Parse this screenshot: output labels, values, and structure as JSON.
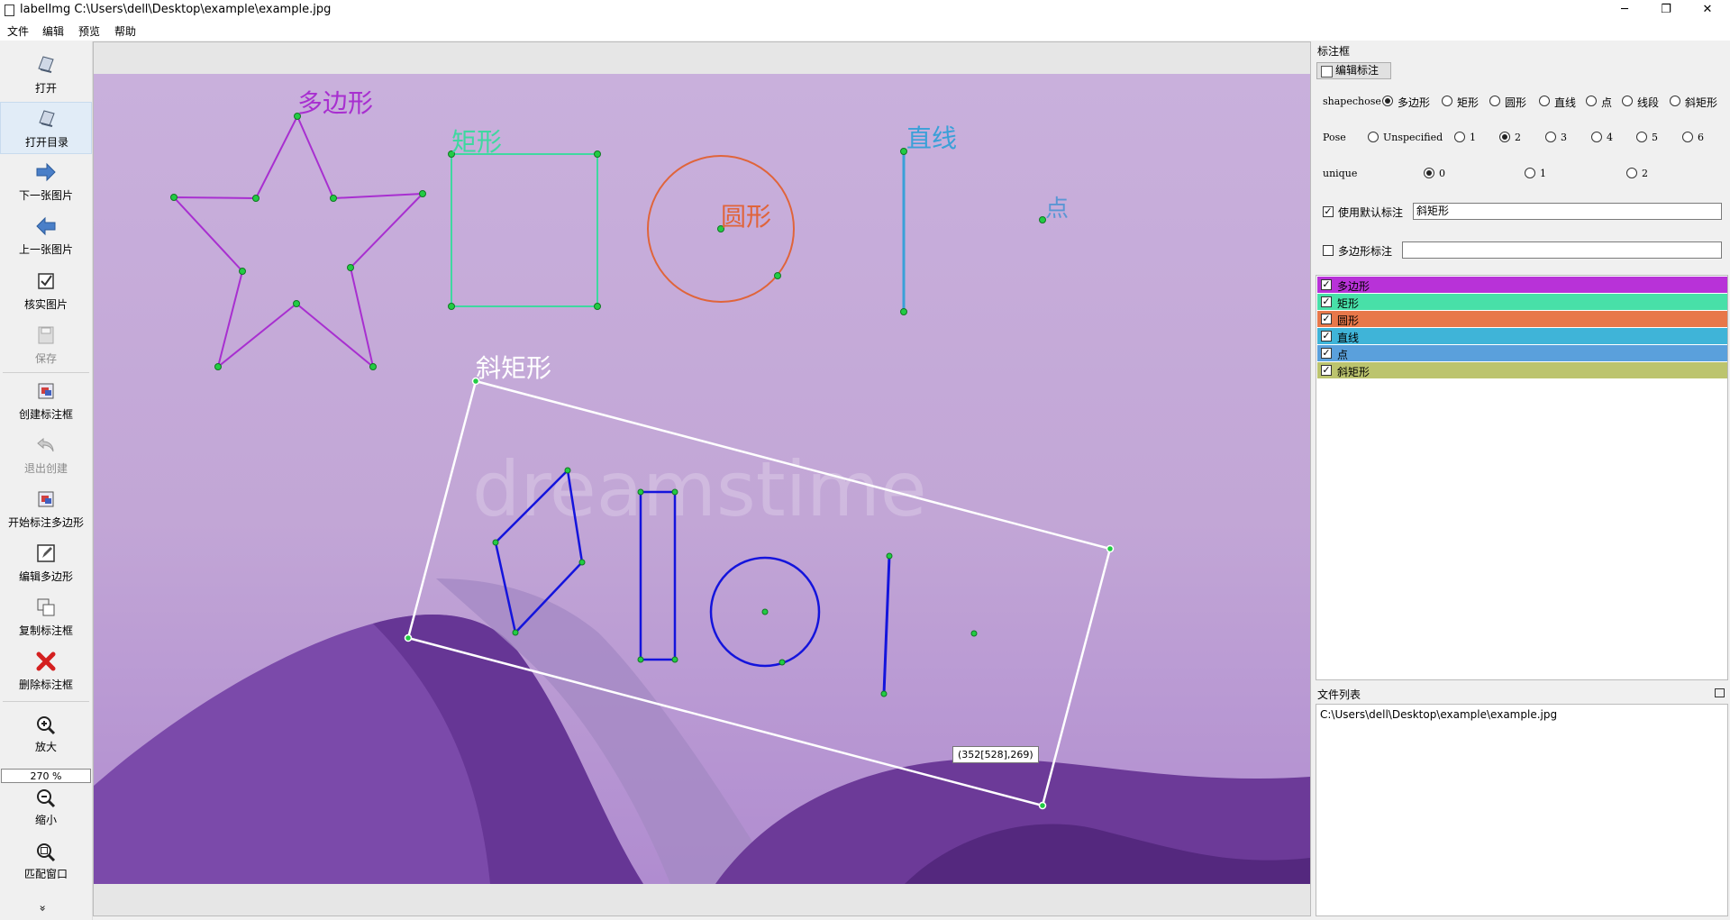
{
  "window": {
    "title": "labelImg C:\\Users\\dell\\Desktop\\example\\example.jpg",
    "minimize": "─",
    "restore": "❐",
    "close": "✕"
  },
  "menu": [
    "文件",
    "编辑",
    "预览",
    "帮助"
  ],
  "toolbar": {
    "items": [
      {
        "label": "打开",
        "icon": "open-icon"
      },
      {
        "label": "打开目录",
        "icon": "open-dir-icon"
      },
      {
        "label": "下一张图片",
        "icon": "arrow-right-icon"
      },
      {
        "label": "上一张图片",
        "icon": "arrow-left-icon"
      },
      {
        "label": "核实图片",
        "icon": "verify-icon"
      },
      {
        "label": "保存",
        "icon": "save-icon"
      },
      {
        "label": "创建标注框",
        "icon": "create-box-icon"
      },
      {
        "label": "退出创建",
        "icon": "undo-icon"
      },
      {
        "label": "开始标注多边形",
        "icon": "polygon-icon"
      },
      {
        "label": "编辑多边形",
        "icon": "edit-icon"
      },
      {
        "label": "复制标注框",
        "icon": "copy-icon"
      },
      {
        "label": "删除标注框",
        "icon": "delete-icon"
      },
      {
        "label": "放大",
        "icon": "zoom-in-icon"
      },
      {
        "label": "缩小",
        "icon": "zoom-out-icon"
      },
      {
        "label": "匹配窗口",
        "icon": "fit-window-icon"
      }
    ],
    "zoom_value": "270 %",
    "more": "»"
  },
  "canvas": {
    "shape_labels": {
      "polygon": "多边形",
      "rectangle": "矩形",
      "circle": "圆形",
      "line": "直线",
      "point": "点",
      "rotated_rect": "斜矩形"
    },
    "coord_tooltip": "(352[528],269)",
    "watermark": "dreamstime"
  },
  "annotation_panel": {
    "title": "标注框",
    "edit_button": "编辑标注",
    "shapechose_label": "shapechose",
    "shape_options": [
      "多边形",
      "矩形",
      "圆形",
      "直线",
      "点",
      "线段",
      "斜矩形"
    ],
    "shape_selected": "多边形",
    "pose_label": "Pose",
    "pose_options": [
      "Unspecified",
      "1",
      "2",
      "3",
      "4",
      "5",
      "6"
    ],
    "pose_selected": "2",
    "unique_label": "unique",
    "unique_options": [
      "0",
      "1",
      "2"
    ],
    "unique_selected": "0",
    "use_default_label": "使用默认标注",
    "use_default_checked": true,
    "default_label_value": "斜矩形",
    "polygon_label": "多边形标注",
    "polygon_checked": false,
    "polygon_label_value": "",
    "labels": [
      {
        "text": "多边形",
        "color": "#b832d8",
        "checked": true
      },
      {
        "text": "矩形",
        "color": "#48e0a8",
        "checked": true
      },
      {
        "text": "圆形",
        "color": "#e8784a",
        "checked": true
      },
      {
        "text": "直线",
        "color": "#3fb4d8",
        "checked": true
      },
      {
        "text": "点",
        "color": "#5aa0dc",
        "checked": true
      },
      {
        "text": "斜矩形",
        "color": "#bcc46e",
        "checked": true
      }
    ]
  },
  "file_panel": {
    "title": "文件列表",
    "files": [
      "C:\\Users\\dell\\Desktop\\example\\example.jpg"
    ]
  },
  "colors": {
    "polygon": "#a82fd0",
    "rectangle": "#3fd8a0",
    "circle": "#e0643a",
    "line": "#3aa0d8",
    "point": "#5a96d4",
    "rotated_rect": "#ffffff",
    "blue_shapes": "#1414dc",
    "vertex": "#22cc44"
  }
}
